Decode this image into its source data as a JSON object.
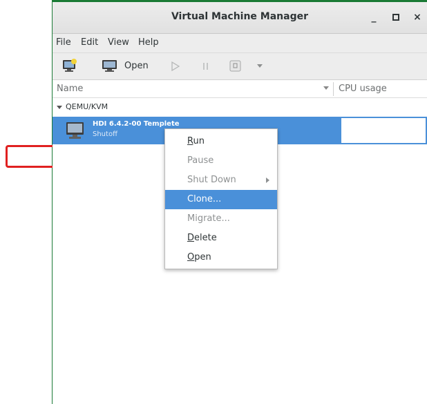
{
  "window": {
    "title": "Virtual Machine Manager",
    "minimize_label": "_",
    "maximize_label": "▫",
    "close_label": "×"
  },
  "menubar": [
    "File",
    "Edit",
    "View",
    "Help"
  ],
  "toolbar": {
    "open_label": "Open"
  },
  "list_header": {
    "name": "Name",
    "cpu": "CPU usage"
  },
  "group": {
    "label": "QEMU/KVM"
  },
  "vm": {
    "name": "HDI 6.4.2-00 Templete",
    "status": "Shutoff"
  },
  "context_menu": {
    "items": [
      {
        "mnemonic": "R",
        "rest": "un",
        "enabled": true
      },
      {
        "mnemonic": "",
        "rest": "Pause",
        "enabled": false
      },
      {
        "mnemonic": "",
        "rest": "Shut Down",
        "enabled": false,
        "submenu": true
      },
      {
        "mnemonic": "",
        "rest": "Clone...",
        "enabled": true,
        "selected": true
      },
      {
        "mnemonic": "",
        "rest": "Migrate...",
        "enabled": false
      },
      {
        "mnemonic": "D",
        "rest": "elete",
        "enabled": true
      },
      {
        "mnemonic": "O",
        "rest": "pen",
        "enabled": true
      }
    ]
  },
  "colors": {
    "selection": "#4a90d9",
    "annotation": "#e02020",
    "frame_accent": "#1a7a35"
  },
  "icons": [
    "new-vm-icon",
    "monitor-icon",
    "run-icon",
    "pause-icon",
    "shutdown-icon",
    "dropdown-arrow-icon",
    "vm-monitor-icon"
  ]
}
